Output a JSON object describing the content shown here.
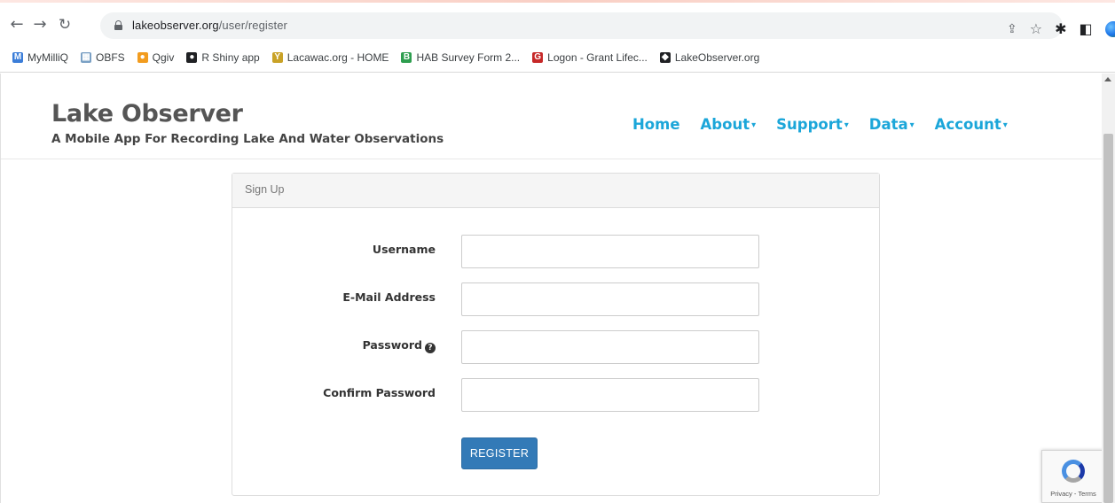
{
  "browser": {
    "url_domain": "lakeobserver.org",
    "url_path": "/user/register",
    "bookmarks": [
      {
        "label": "MyMilliQ",
        "color": "#3b7dd8",
        "icon": "M"
      },
      {
        "label": "OBFS",
        "color": "#7aa0c4",
        "icon": "▦"
      },
      {
        "label": "Qgiv",
        "color": "#f29c1f",
        "icon": "●"
      },
      {
        "label": "R Shiny app",
        "color": "#202124",
        "icon": "●"
      },
      {
        "label": "Lacawac.org - HOME",
        "color": "#c9a227",
        "icon": "Y"
      },
      {
        "label": "HAB Survey Form 2...",
        "color": "#2e9e4f",
        "icon": "B"
      },
      {
        "label": "Logon - Grant Lifec...",
        "color": "#c62828",
        "icon": "G"
      },
      {
        "label": "LakeObserver.org",
        "color": "#202124",
        "icon": "◆"
      }
    ]
  },
  "site": {
    "title": "Lake Observer",
    "subtitle": "A Mobile App For Recording Lake And Water Observations",
    "nav": {
      "home": "Home",
      "about": "About",
      "support": "Support",
      "data": "Data",
      "account": "Account"
    }
  },
  "form": {
    "heading": "Sign Up",
    "username_label": "Username",
    "email_label": "E-Mail Address",
    "password_label": "Password",
    "confirm_label": "Confirm Password",
    "register_label": "REGISTER"
  },
  "recaptcha": {
    "text": "Privacy - Terms"
  },
  "colors": {
    "nav_link": "#1ba6d9",
    "button": "#337ab7"
  }
}
